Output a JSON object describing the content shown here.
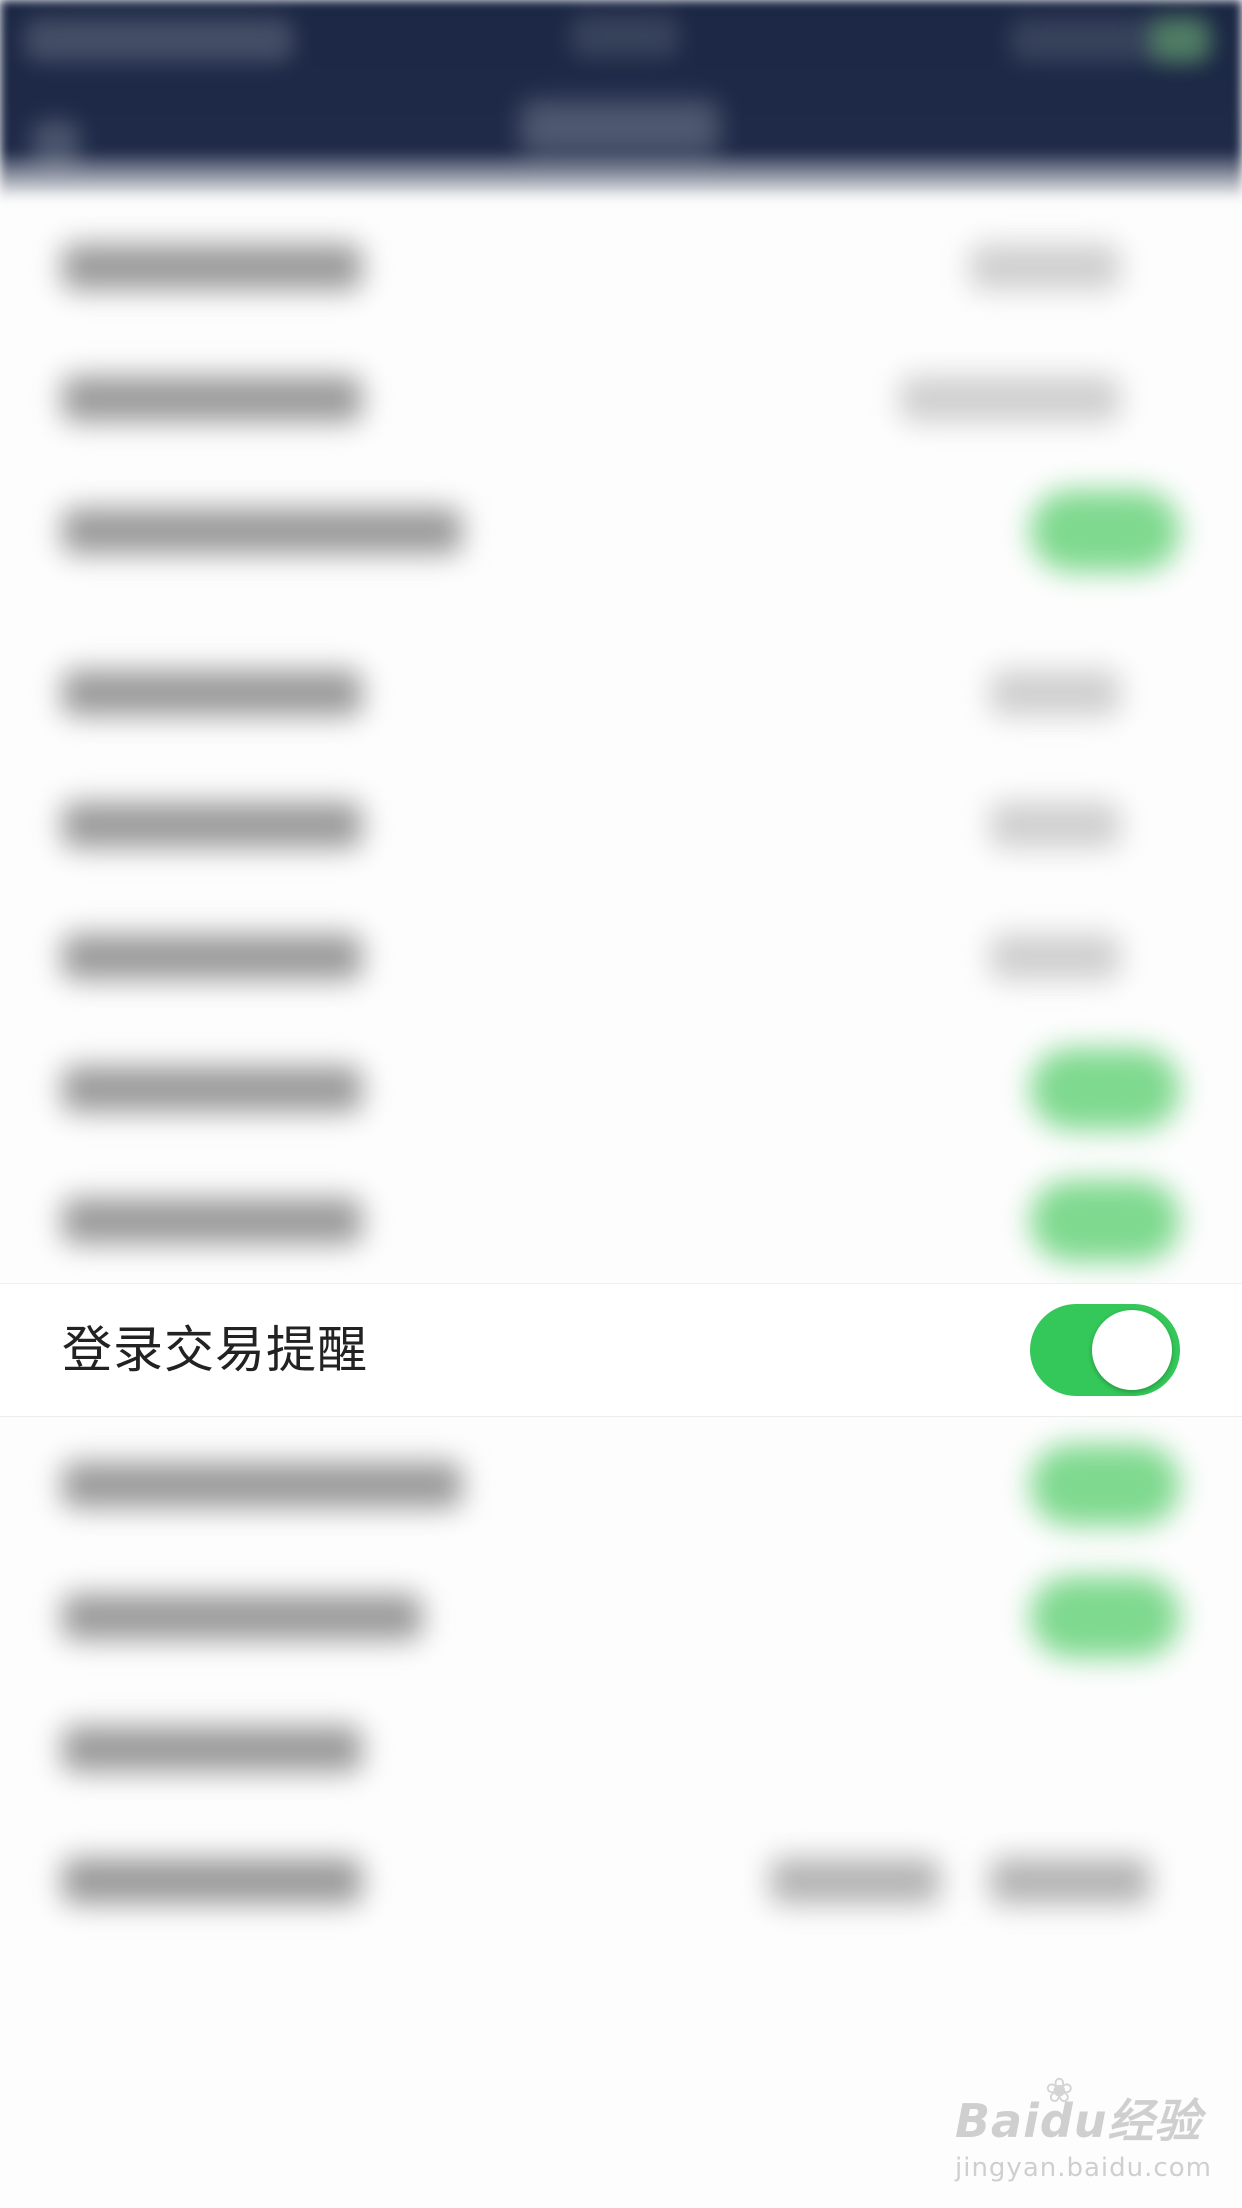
{
  "highlighted_setting": {
    "label": "登录交易提醒",
    "toggle_on": true,
    "toggle_color": "#34c759"
  },
  "toggle_color_blurred": "#7fd98f",
  "header_color": "#1b2744",
  "watermark": {
    "icon": "paw-icon",
    "logo": "Baidu经验",
    "url": "jingyan.baidu.com"
  }
}
